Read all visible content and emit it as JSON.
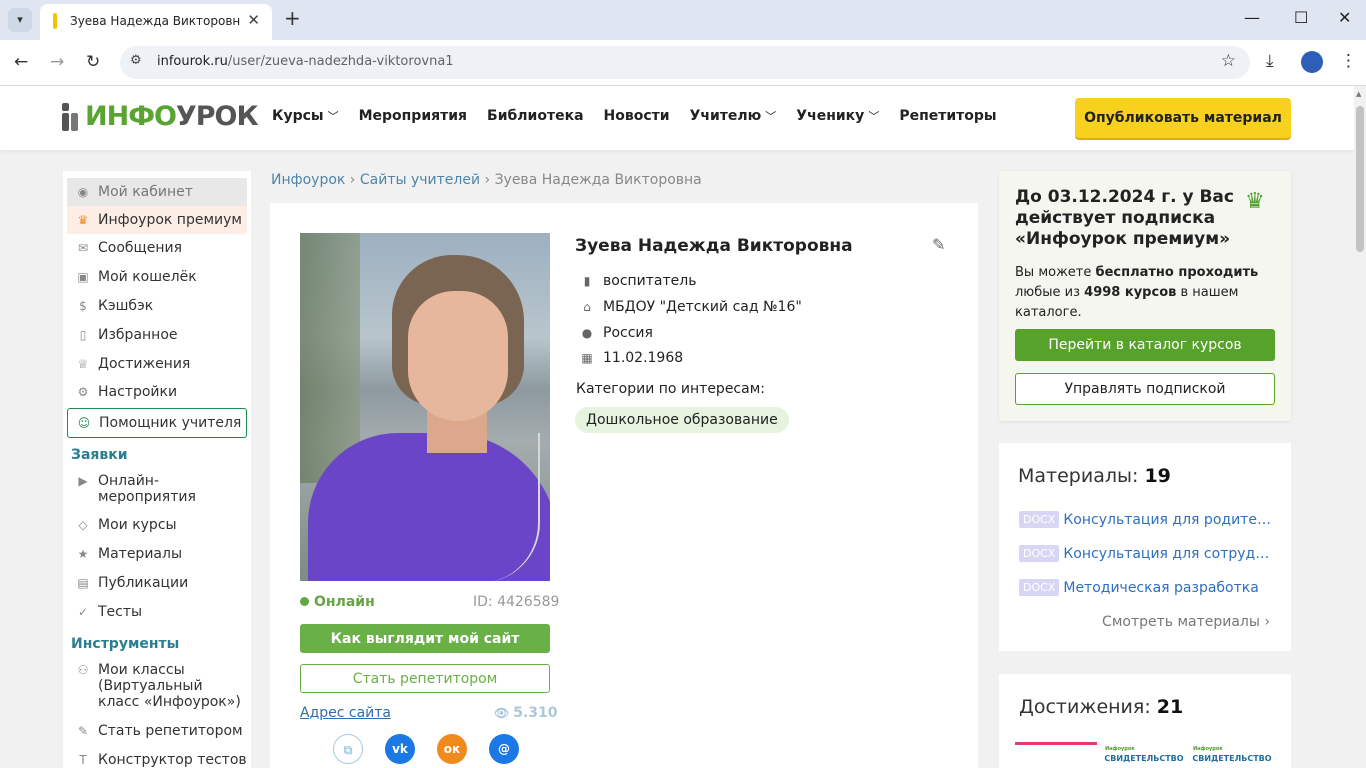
{
  "browser": {
    "tab_title": "Зуева Надежда Викторовна - Инфоурок",
    "url_host": "infourok.ru",
    "url_path": "/user/zueva-nadezhda-viktorovna1"
  },
  "header": {
    "logo_green": "ИНФО",
    "logo_dark": "УРОК",
    "nav": [
      {
        "label": "Курсы",
        "has_dropdown": true
      },
      {
        "label": "Мероприятия",
        "has_dropdown": false
      },
      {
        "label": "Библиотека",
        "has_dropdown": false
      },
      {
        "label": "Новости",
        "has_dropdown": false
      },
      {
        "label": "Учителю",
        "has_dropdown": true
      },
      {
        "label": "Ученику",
        "has_dropdown": true
      },
      {
        "label": "Репетиторы",
        "has_dropdown": false
      }
    ],
    "publish_label": "Опубликовать материал"
  },
  "sidebar": {
    "items": [
      {
        "label": "Мой кабинет",
        "icon": "user-circle-icon"
      },
      {
        "label": "Инфоурок премиум",
        "icon": "crown-icon"
      },
      {
        "label": "Сообщения",
        "icon": "envelope-icon"
      },
      {
        "label": "Мой кошелёк",
        "icon": "wallet-icon"
      },
      {
        "label": "Кэшбэк",
        "icon": "coin-icon"
      },
      {
        "label": "Избранное",
        "icon": "bookmark-icon"
      },
      {
        "label": "Достижения",
        "icon": "trophy-icon"
      },
      {
        "label": "Настройки",
        "icon": "gear-icon"
      },
      {
        "label": "Помощник учителя",
        "icon": "assistant-icon"
      }
    ],
    "section_requests": "Заявки",
    "requests": [
      {
        "label": "Онлайн-мероприятия",
        "icon": "play-icon"
      },
      {
        "label": "Мои курсы",
        "icon": "graduation-cap-icon"
      },
      {
        "label": "Материалы",
        "icon": "star-icon"
      },
      {
        "label": "Публикации",
        "icon": "book-icon"
      },
      {
        "label": "Тесты",
        "icon": "check-circle-icon"
      }
    ],
    "section_tools": "Инструменты",
    "tools": [
      {
        "label": "Мои классы (Виртуальный класс «Инфоурок»)",
        "icon": "people-icon"
      },
      {
        "label": "Стать репетитором",
        "icon": "teacher-icon"
      },
      {
        "label": "Конструктор тестов",
        "icon": "text-icon"
      }
    ]
  },
  "breadcrumb": {
    "home": "Инфоурок",
    "sites": "Сайты учителей",
    "current": "Зуева Надежда Викторовна"
  },
  "profile": {
    "name": "Зуева Надежда Викторовна",
    "position": "воспитатель",
    "organization": "МБДОУ \"Детский сад №16\"",
    "country": "Россия",
    "birth_date": "11.02.1968",
    "categories_label": "Категории по интересам:",
    "category": "Дошкольное образование",
    "status": "Онлайн",
    "id_text": "ID: 4426589",
    "site_button": "Как выглядит мой сайт",
    "tutor_button": "Стать репетитором",
    "site_link": "Адрес сайта",
    "views": "5.310"
  },
  "premium": {
    "title": "До 03.12.2024 г. у Вас действует подписка «Инфоурок премиум»",
    "text_1": "Вы можете ",
    "text_bold_1": "бесплатно проходить",
    "text_2": " любые из ",
    "text_bold_2": "4998 курсов",
    "text_3": " в нашем каталоге.",
    "catalog_button": "Перейти в каталог курсов",
    "manage_button": "Управлять подпиской"
  },
  "materials": {
    "title": "Материалы:",
    "count": "19",
    "items": [
      {
        "badge": "DOCX",
        "title": "Консультация для родителей"
      },
      {
        "badge": "DOCX",
        "title": "Консультация для сотрудников"
      },
      {
        "badge": "DOCX",
        "title": "Методическая разработка"
      }
    ],
    "more": "Смотреть материалы ›"
  },
  "achievements": {
    "title": "Достижения:",
    "count": "21",
    "thumbs": [
      {
        "caption": "",
        "brand": ""
      },
      {
        "caption": "СВИДЕТЕЛЬСТВО",
        "brand": "Инфоурок"
      },
      {
        "caption": "СВИДЕТЕЛЬСТВО",
        "brand": "Инфоурок"
      }
    ]
  },
  "colors": {
    "brand_green": "#5aa532",
    "publish_yellow": "#f7d11e",
    "link_blue": "#2d6fc0",
    "section_teal": "#2a7f8f"
  }
}
